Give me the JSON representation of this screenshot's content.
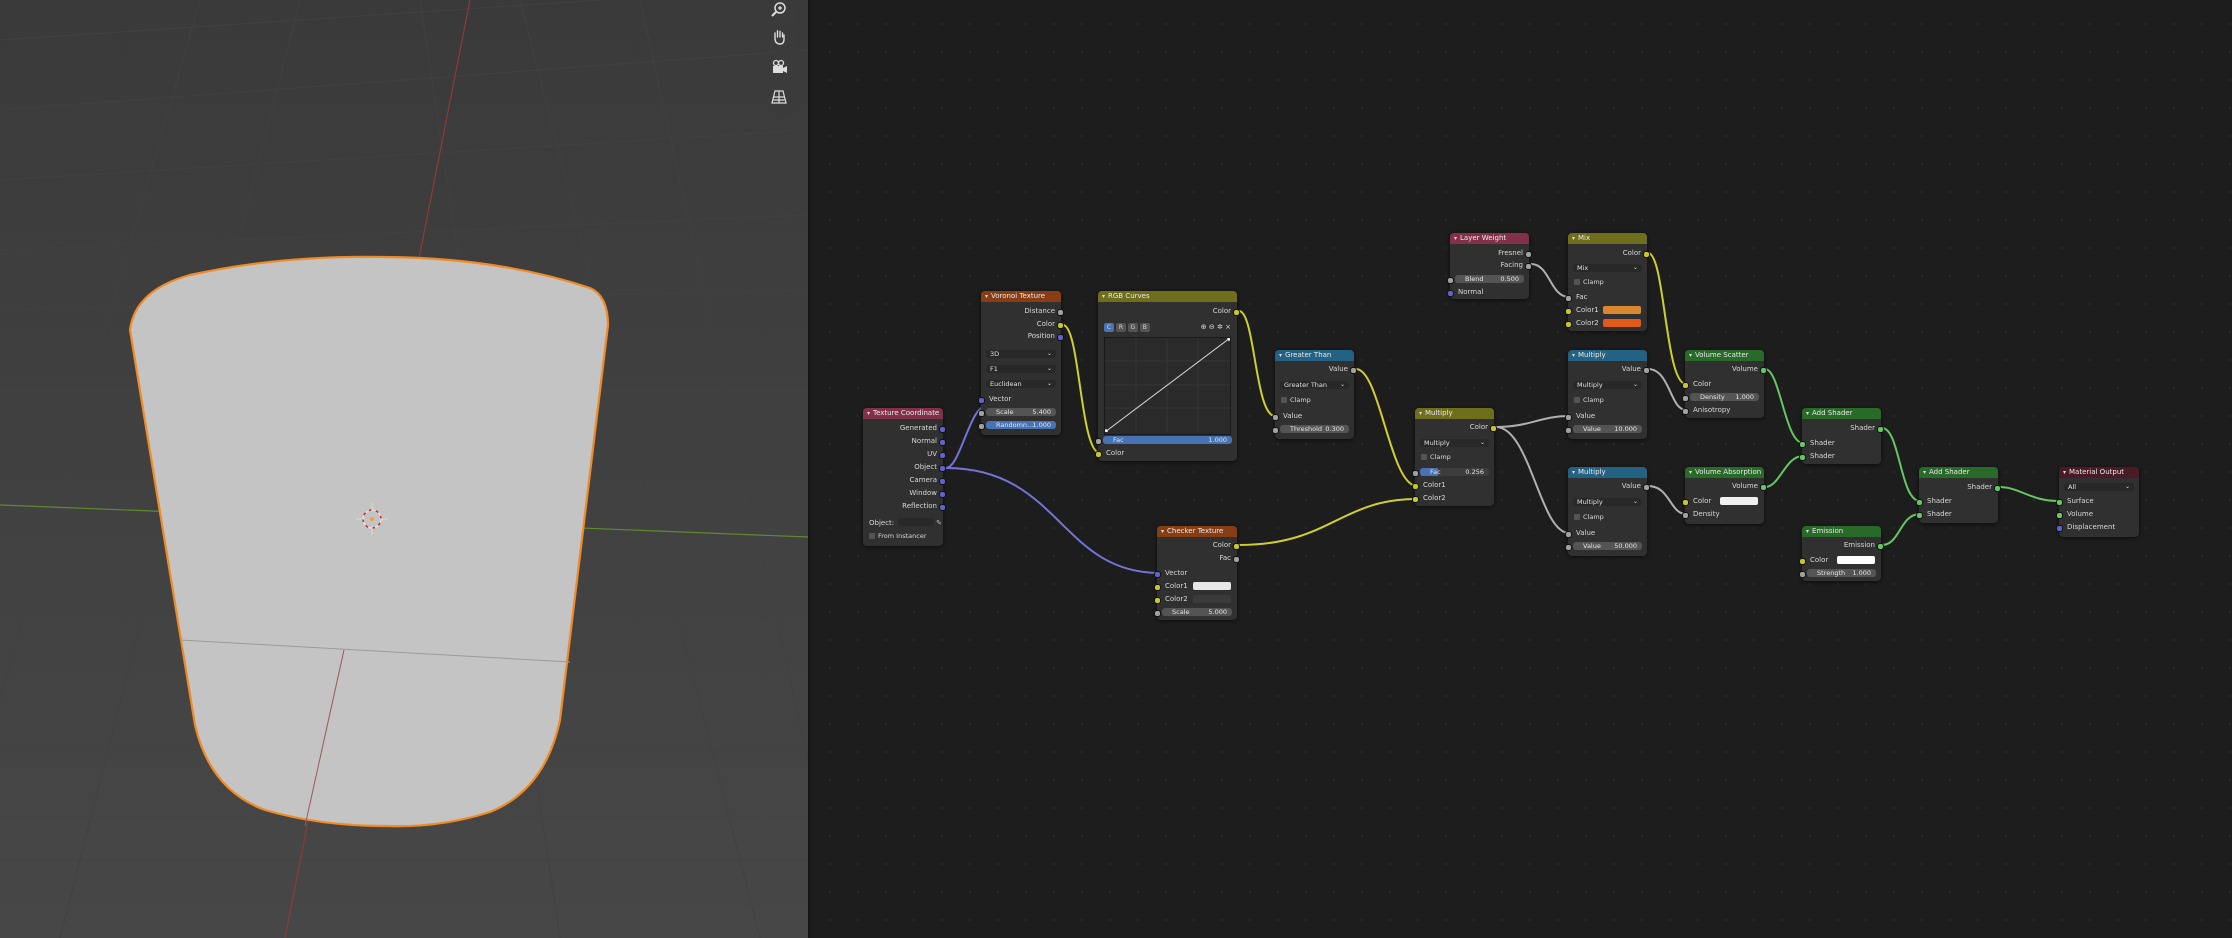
{
  "colors": {
    "attr": "#83314a",
    "tex": "#883e15",
    "color": "#6e6e1d",
    "conv": "#246283",
    "shader": "#286a28",
    "output": "#4a1a25",
    "socket_color": "#c7c729",
    "socket_float": "#a1a1a1",
    "socket_vector": "#6363c7",
    "socket_shader": "#63c763"
  },
  "viewport": {
    "tools": [
      "zoom-icon",
      "hand-pan-icon",
      "camera-icon",
      "perspective-grid-icon"
    ]
  },
  "nodes": {
    "texcoord": {
      "title": "Texture Coordinate",
      "outputs": [
        "Generated",
        "Normal",
        "UV",
        "Object",
        "Camera",
        "Window",
        "Reflection"
      ],
      "object_label": "Object:",
      "from_instancer": "From Instancer"
    },
    "voronoi": {
      "title": "Voronoi Texture",
      "outputs": [
        "Distance",
        "Color",
        "Position"
      ],
      "dims": "3D",
      "feature": "F1",
      "metric": "Euclidean",
      "vector": "Vector",
      "scale_k": "Scale",
      "scale_v": "5.400",
      "rand_k": "Randomn...",
      "rand_v": "1.000"
    },
    "rgbcurves": {
      "title": "RGB Curves",
      "output": "Color",
      "channels": [
        "C",
        "R",
        "G",
        "B"
      ],
      "fac_k": "Fac",
      "fac_v": "1.000",
      "color_in": "Color"
    },
    "checker": {
      "title": "Checker Texture",
      "outputs": [
        "Color",
        "Fac"
      ],
      "vector": "Vector",
      "color1": "Color1",
      "color2": "Color2",
      "scale_k": "Scale",
      "scale_v": "5.000"
    },
    "greater": {
      "title": "Greater Than",
      "output": "Value",
      "op": "Greater Than",
      "clamp": "Clamp",
      "value_in": "Value",
      "thr_k": "Threshold",
      "thr_v": "0.300"
    },
    "mult1": {
      "title": "Multiply",
      "output": "Color",
      "op": "Multiply",
      "clamp": "Clamp",
      "fac_k": "Fac",
      "fac_v": "0.256",
      "c1": "Color1",
      "c2": "Color2"
    },
    "layerweight": {
      "title": "Layer Weight",
      "outputs": [
        "Fresnel",
        "Facing"
      ],
      "blend_k": "Blend",
      "blend_v": "0.500",
      "normal": "Normal"
    },
    "mix": {
      "title": "Mix",
      "output": "Color",
      "op": "Mix",
      "clamp": "Clamp",
      "fac": "Fac",
      "c1": "Color1",
      "c2": "Color2",
      "c1_color": "#d9882f",
      "c2_color": "#e05a1a"
    },
    "mult2": {
      "title": "Multiply",
      "output": "Value",
      "op": "Multiply",
      "clamp": "Clamp",
      "value_in": "Value",
      "val_k": "Value",
      "val_v": "10.000"
    },
    "mult3": {
      "title": "Multiply",
      "output": "Value",
      "op": "Multiply",
      "clamp": "Clamp",
      "value_in": "Value",
      "val_k": "Value",
      "val_v": "50.000"
    },
    "volscatter": {
      "title": "Volume Scatter",
      "output": "Volume",
      "color": "Color",
      "den_k": "Density",
      "den_v": "1.000",
      "aniso": "Anisotropy"
    },
    "volabs": {
      "title": "Volume Absorption",
      "output": "Volume",
      "color": "Color",
      "density": "Density"
    },
    "add1": {
      "title": "Add Shader",
      "output": "Shader",
      "in1": "Shader",
      "in2": "Shader"
    },
    "add2": {
      "title": "Add Shader",
      "output": "Shader",
      "in1": "Shader",
      "in2": "Shader"
    },
    "emission": {
      "title": "Emission",
      "output": "Emission",
      "color": "Color",
      "str_k": "Strength",
      "str_v": "1.000"
    },
    "matout": {
      "title": "Material Output",
      "target": "All",
      "inputs": [
        "Surface",
        "Volume",
        "Displacement"
      ]
    }
  }
}
